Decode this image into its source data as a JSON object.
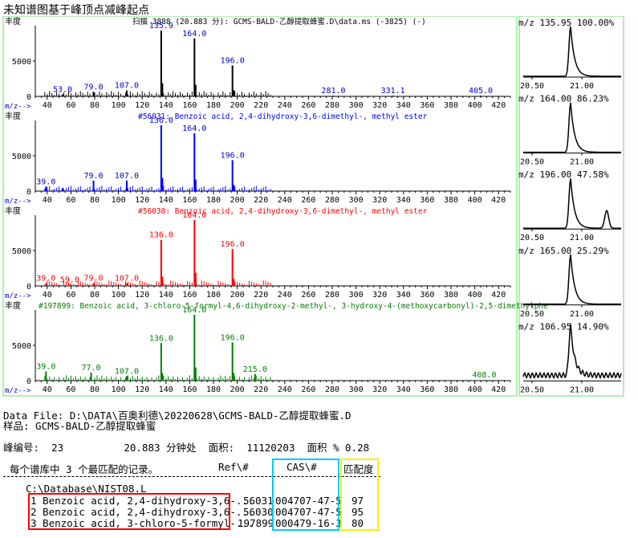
{
  "window_title": "未知谱图基于峰顶点减峰起点",
  "spectra": [
    {
      "ylabel": "丰度",
      "header": "扫描 3888 (20.883 分): GCMS-BALD-乙醇提取蜂蜜.D\\data.ms (-3825) (-)",
      "color": "#000000",
      "xlabel": "m/z-->",
      "peaks": [
        [
          53,
          3
        ],
        [
          79,
          7
        ],
        [
          107,
          9
        ],
        [
          136,
          100
        ],
        [
          164,
          88
        ],
        [
          196,
          47
        ],
        [
          281,
          1
        ],
        [
          331.1,
          1
        ],
        [
          405,
          1
        ]
      ],
      "labels": [
        [
          "53.0",
          53
        ],
        [
          "79.0",
          79
        ],
        [
          "107.0",
          107
        ],
        [
          "135.9",
          136
        ],
        [
          "164.0",
          164
        ],
        [
          "196.0",
          196
        ],
        [
          "281.0",
          281
        ],
        [
          "331.1",
          331.1
        ],
        [
          "405.0",
          405
        ]
      ]
    },
    {
      "ylabel": "丰度",
      "header": "#56031: Benzoic acid, 2,4-dihydroxy-3,6-dimethyl-, methyl ester",
      "color": "#0000ff",
      "xlabel": "m/z-->",
      "peaks": [
        [
          39,
          7
        ],
        [
          53,
          5
        ],
        [
          79,
          16
        ],
        [
          107,
          16
        ],
        [
          136,
          100
        ],
        [
          164,
          88
        ],
        [
          196,
          47
        ]
      ],
      "labels": [
        [
          "39.0",
          39
        ],
        [
          "79.0",
          79
        ],
        [
          "107.0",
          107
        ],
        [
          "136.0",
          136
        ],
        [
          "164.0",
          164
        ],
        [
          "196.0",
          196
        ]
      ]
    },
    {
      "ylabel": "丰度",
      "header": "#56030: Benzoic acid, 2,4-dihydroxy-3,6-dimethyl-, methyl ester",
      "color": "#ff0000",
      "xlabel": "m/z-->",
      "peaks": [
        [
          39,
          4
        ],
        [
          59,
          2
        ],
        [
          79,
          4
        ],
        [
          107,
          4
        ],
        [
          136,
          70
        ],
        [
          164,
          100
        ],
        [
          196,
          56
        ]
      ],
      "labels": [
        [
          "39.0",
          39
        ],
        [
          "59.0",
          59
        ],
        [
          "79.0",
          79
        ],
        [
          "107.0",
          107
        ],
        [
          "136.0",
          136
        ],
        [
          "164.0",
          164
        ],
        [
          "196.0",
          196
        ]
      ]
    },
    {
      "ylabel": "丰度",
      "header": "#197899: Benzoic acid, 3-chloro-5-formyl-4,6-dihydroxy-2-methyl-, 3-hydroxy-4-(methoxycarbonyl)-2,5-dimethylphe",
      "color": "#008000",
      "xlabel": "m/z-->",
      "peaks": [
        [
          39,
          14
        ],
        [
          77,
          12
        ],
        [
          107,
          7
        ],
        [
          136,
          57
        ],
        [
          164,
          100
        ],
        [
          196,
          58
        ],
        [
          215,
          10
        ],
        [
          408,
          1
        ]
      ],
      "labels": [
        [
          "39.0",
          39
        ],
        [
          "77.0",
          77
        ],
        [
          "107.0",
          107
        ],
        [
          "136.0",
          136
        ],
        [
          "164.0",
          164
        ],
        [
          "196.0",
          196
        ],
        [
          "215.0",
          215
        ],
        [
          "408.0",
          408
        ]
      ]
    }
  ],
  "x_ticks": [
    "40",
    "60",
    "80",
    "100",
    "120",
    "140",
    "160",
    "180",
    "200",
    "220",
    "240",
    "260",
    "280",
    "300",
    "320",
    "340",
    "360",
    "380",
    "400",
    "420"
  ],
  "y_tick": "5000",
  "chromatograms": [
    {
      "label": "m/z 135.95  100.00%",
      "shape": 1
    },
    {
      "label": "m/z 164.00  86.23%",
      "shape": 1
    },
    {
      "label": "m/z 196.00  47.58%",
      "shape": 2
    },
    {
      "label": "m/z 165.00  25.29%",
      "shape": 1
    },
    {
      "label": "m/z 106.95  14.90%",
      "shape": 3
    }
  ],
  "chrom_ticks": [
    "20.50",
    "21.00"
  ],
  "data_file_line": "Data File: D:\\DATA\\百奥利德\\20220628\\GCMS-BALD-乙醇提取蜂蜜.D",
  "sample_line": "样品: GCMS-BALD-乙醇提取蜂蜜",
  "peak_line": "峰编号:  23          20.883 分钟处  面积:  11120203  面积 % 0.28",
  "table": {
    "caption": "每个谱库中 3 个最匹配的记录。",
    "col_ref": "Ref\\#",
    "col_cas": "CAS\\#",
    "col_match": "匹配度",
    "library": "C:\\Database\\NIST08.L",
    "rows": [
      {
        "name": "1 Benzoic acid, 2,4-dihydroxy-3,6-...",
        "ref": "56031",
        "cas": "004707-47-5",
        "match": "97"
      },
      {
        "name": "2 Benzoic acid, 2,4-dihydroxy-3,6-...",
        "ref": "56030",
        "cas": "004707-47-5",
        "match": "95"
      },
      {
        "name": "3 Benzoic acid, 3-chloro-5-formyl-...",
        "ref": "197899",
        "cas": "000479-16-3",
        "match": "80"
      }
    ]
  },
  "colors": {
    "frame": "#66dd66",
    "name_box": "#ff0000",
    "cas_box": "#00c8ff",
    "match_box": "#ffee00",
    "label_blue": "#0000cc",
    "label_red": "#ff0000",
    "label_green": "#008000"
  }
}
